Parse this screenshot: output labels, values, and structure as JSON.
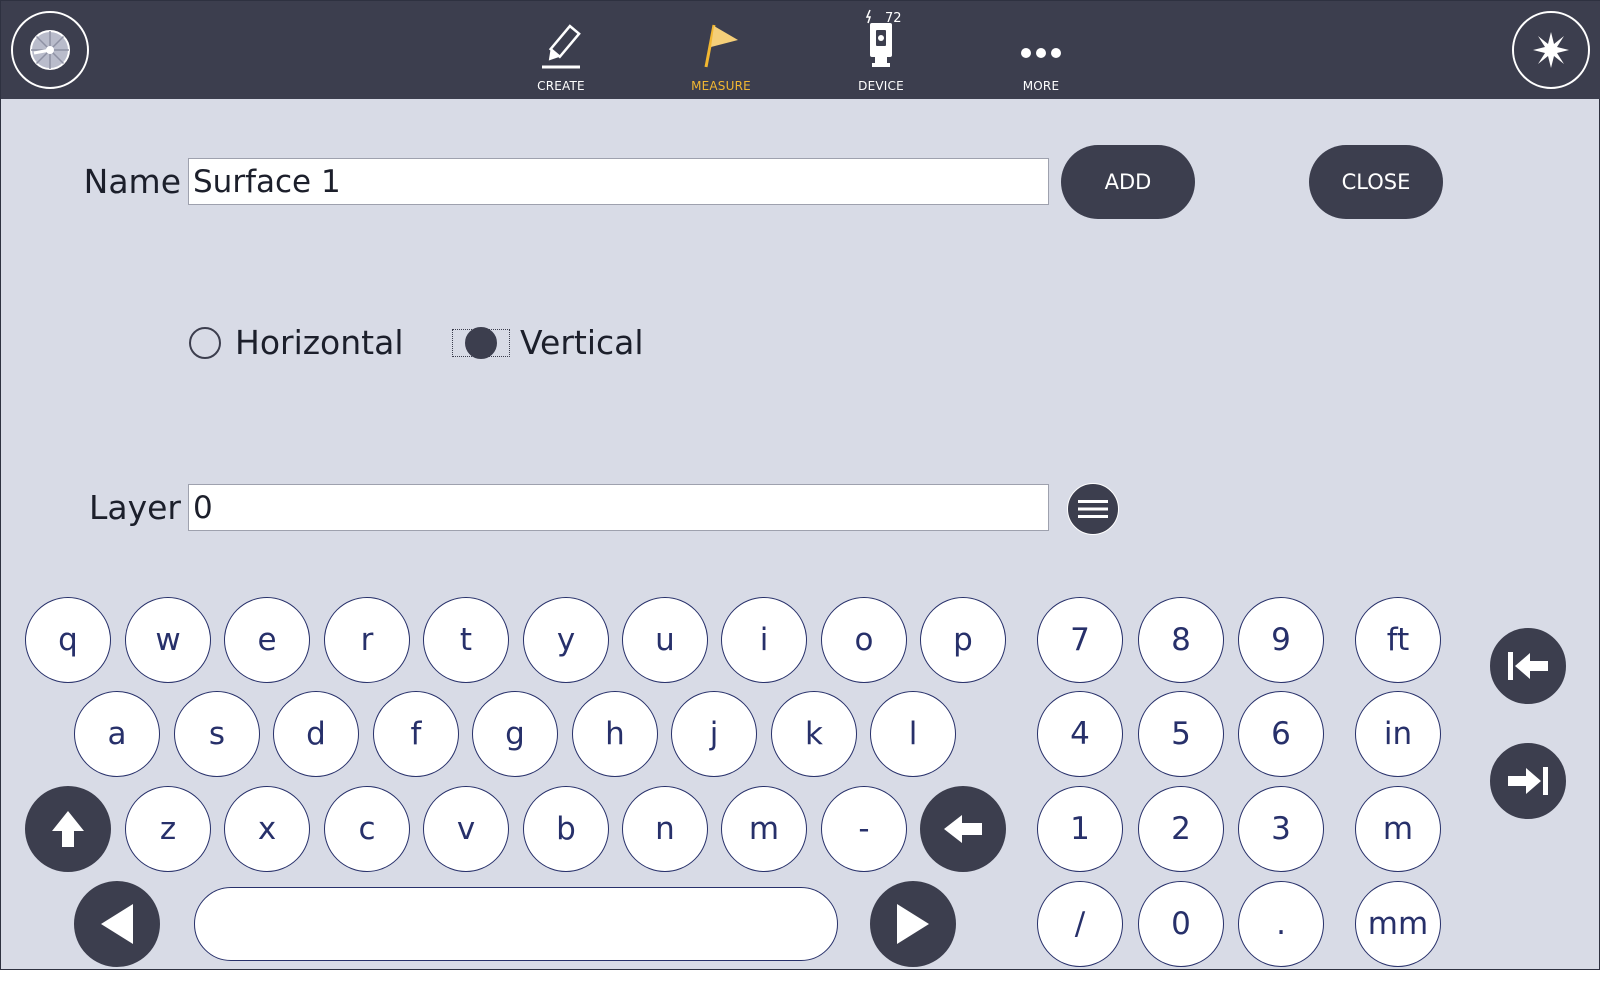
{
  "colors": {
    "topbar": "#3c3e4e",
    "background": "#d8dbe6",
    "accent_active": "#f2b731",
    "key_text": "#27306a",
    "dark_button": "#3c3e4e"
  },
  "topbar": {
    "left_button_icon": "compass-icon",
    "right_button_icon": "laser-burst-icon",
    "nav": [
      {
        "label": "CREATE",
        "icon": "pencil-icon",
        "active": false
      },
      {
        "label": "MEASURE",
        "icon": "flag-icon",
        "active": true
      },
      {
        "label": "DEVICE",
        "icon": "total-station-icon",
        "badge": "72",
        "active": false
      },
      {
        "label": "MORE",
        "icon": "more-dots-icon",
        "active": false
      }
    ]
  },
  "form": {
    "name_label": "Name",
    "name_value": "Surface 1",
    "add_label": "ADD",
    "close_label": "CLOSE",
    "orientation": {
      "options": [
        "Horizontal",
        "Vertical"
      ],
      "selected": "Vertical"
    },
    "layer_label": "Layer",
    "layer_value": "0",
    "layer_menu_icon": "menu-icon"
  },
  "keyboard": {
    "rows": [
      [
        "q",
        "w",
        "e",
        "r",
        "t",
        "y",
        "u",
        "i",
        "o",
        "p"
      ],
      [
        "a",
        "s",
        "d",
        "f",
        "g",
        "h",
        "j",
        "k",
        "l"
      ],
      [
        "z",
        "x",
        "c",
        "v",
        "b",
        "n",
        "m",
        "-"
      ]
    ],
    "numpad": [
      [
        "7",
        "8",
        "9"
      ],
      [
        "4",
        "5",
        "6"
      ],
      [
        "1",
        "2",
        "3"
      ],
      [
        "/",
        "0",
        "."
      ]
    ],
    "units": [
      "ft",
      "in",
      "m",
      "mm"
    ],
    "special_icons": {
      "shift": "shift-arrow-icon",
      "backspace": "backspace-arrow-icon",
      "cursor_left": "cursor-left-icon",
      "cursor_right": "cursor-right-icon",
      "space": "space-bar",
      "jump_start": "jump-to-start-icon",
      "jump_end": "jump-to-end-icon"
    }
  }
}
